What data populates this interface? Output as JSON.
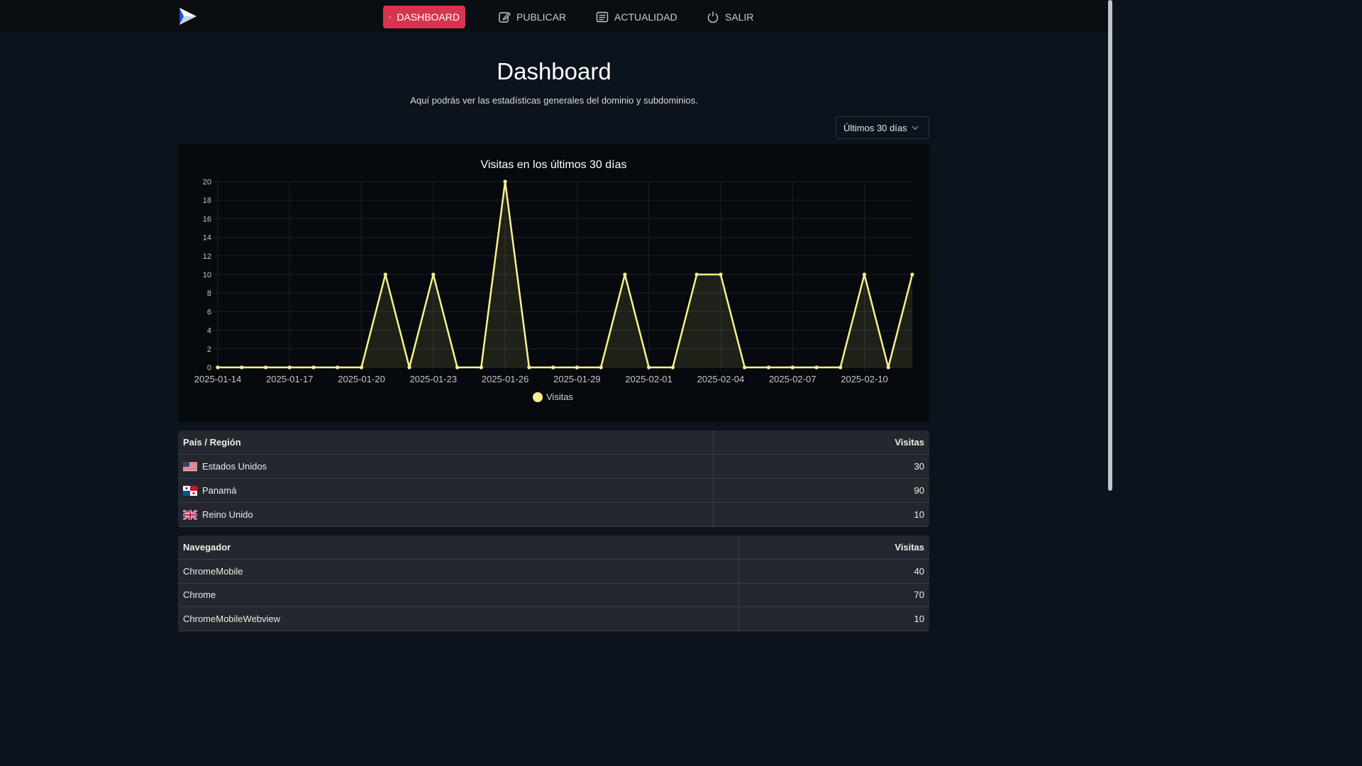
{
  "nav": {
    "items": [
      {
        "label": "DASHBOARD",
        "icon": "dashboard-icon",
        "active": true
      },
      {
        "label": "PUBLICAR",
        "icon": "edit-icon",
        "active": false
      },
      {
        "label": "ACTUALIDAD",
        "icon": "news-icon",
        "active": false
      },
      {
        "label": "SALIR",
        "icon": "power-icon",
        "active": false
      }
    ]
  },
  "header": {
    "title": "Dashboard",
    "subtitle": "Aquí podrás ver las estadísticas generales del dominio y subdominios."
  },
  "range_select": {
    "value": "Últimos 30 días"
  },
  "colors": {
    "accent": "#d8344e",
    "series": "#fbf18c",
    "background": "#0b131c"
  },
  "chart_data": {
    "type": "line",
    "title": "Visitas en los últimos 30 días",
    "xlabel": "",
    "ylabel": "",
    "ylim": [
      0,
      20
    ],
    "y_ticks": [
      0,
      2,
      4,
      6,
      8,
      10,
      12,
      14,
      16,
      18,
      20
    ],
    "x_tick_labels": [
      "2025-01-14",
      "2025-01-17",
      "2025-01-20",
      "2025-01-23",
      "2025-01-26",
      "2025-01-29",
      "2025-02-01",
      "2025-02-04",
      "2025-02-07",
      "2025-02-10"
    ],
    "x": [
      "2025-01-14",
      "2025-01-15",
      "2025-01-16",
      "2025-01-17",
      "2025-01-18",
      "2025-01-19",
      "2025-01-20",
      "2025-01-21",
      "2025-01-22",
      "2025-01-23",
      "2025-01-24",
      "2025-01-25",
      "2025-01-26",
      "2025-01-27",
      "2025-01-28",
      "2025-01-29",
      "2025-01-30",
      "2025-01-31",
      "2025-02-01",
      "2025-02-02",
      "2025-02-03",
      "2025-02-04",
      "2025-02-05",
      "2025-02-06",
      "2025-02-07",
      "2025-02-08",
      "2025-02-09",
      "2025-02-10",
      "2025-02-11",
      "2025-02-12"
    ],
    "series": [
      {
        "name": "Visitas",
        "values": [
          0,
          0,
          0,
          0,
          0,
          0,
          0,
          10,
          0,
          10,
          0,
          0,
          20,
          0,
          0,
          0,
          0,
          10,
          0,
          0,
          10,
          10,
          0,
          0,
          0,
          0,
          0,
          10,
          0,
          10
        ]
      }
    ],
    "grid": true,
    "legend": "bottom"
  },
  "countries_table": {
    "headers": {
      "name": "País / Región",
      "visits": "Visitas"
    },
    "rows": [
      {
        "flag": "us-flag-icon",
        "name": "Estados Unidos",
        "visits": "30"
      },
      {
        "flag": "pa-flag-icon",
        "name": "Panamá",
        "visits": "90"
      },
      {
        "flag": "gb-flag-icon",
        "name": "Reino Unido",
        "visits": "10"
      }
    ]
  },
  "browsers_table": {
    "headers": {
      "name": "Navegador",
      "visits": "Visitas"
    },
    "rows": [
      {
        "name": "ChromeMobile",
        "visits": "40"
      },
      {
        "name": "Chrome",
        "visits": "70"
      },
      {
        "name": "ChromeMobileWebview",
        "visits": "10"
      }
    ]
  }
}
